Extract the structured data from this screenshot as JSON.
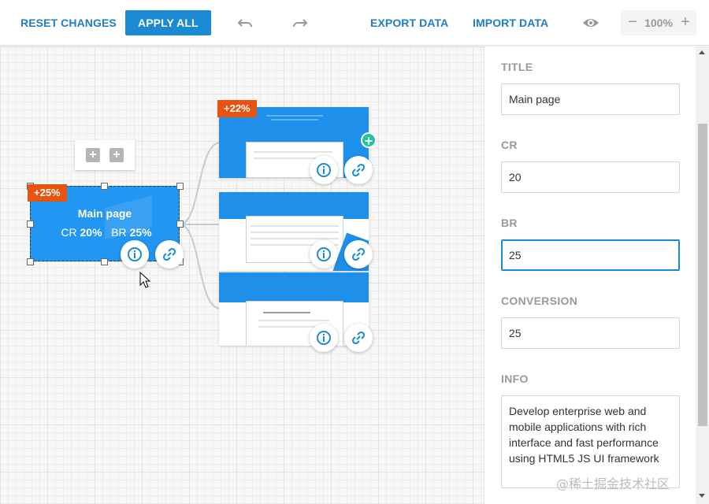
{
  "toolbar": {
    "reset_label": "RESET CHANGES",
    "apply_label": "APPLY ALL",
    "export_label": "EXPORT DATA",
    "import_label": "IMPORT DATA",
    "zoom_value": "100%",
    "zoom_minus": "−",
    "zoom_plus": "+",
    "icons": [
      "undo-icon",
      "redo-icon",
      "eye-icon"
    ]
  },
  "canvas": {
    "add_buttons": [
      "+",
      "+"
    ],
    "main_node": {
      "title": "Main page",
      "cr_label": "CR",
      "cr_value": "20%",
      "br_label": "BR",
      "br_value": "25%",
      "badge": "+25%"
    },
    "child_badge": "+22%",
    "child_count": 3
  },
  "panel": {
    "title_label": "TITLE",
    "title_value": "Main page",
    "cr_label": "CR",
    "cr_value": "20",
    "br_label": "BR",
    "br_value": "25",
    "conversion_label": "CONVERSION",
    "conversion_value": "25",
    "info_label": "INFO",
    "info_value": "Develop enterprise web and mobile applications with rich interface and fast performance using HTML5 JS UI framework"
  },
  "watermark": "@稀土掘金技术社区",
  "colors": {
    "accent": "#1a8ad4",
    "node_blue": "#2196f3",
    "badge_orange": "#e8530e",
    "add_green": "#1fc4a0"
  }
}
